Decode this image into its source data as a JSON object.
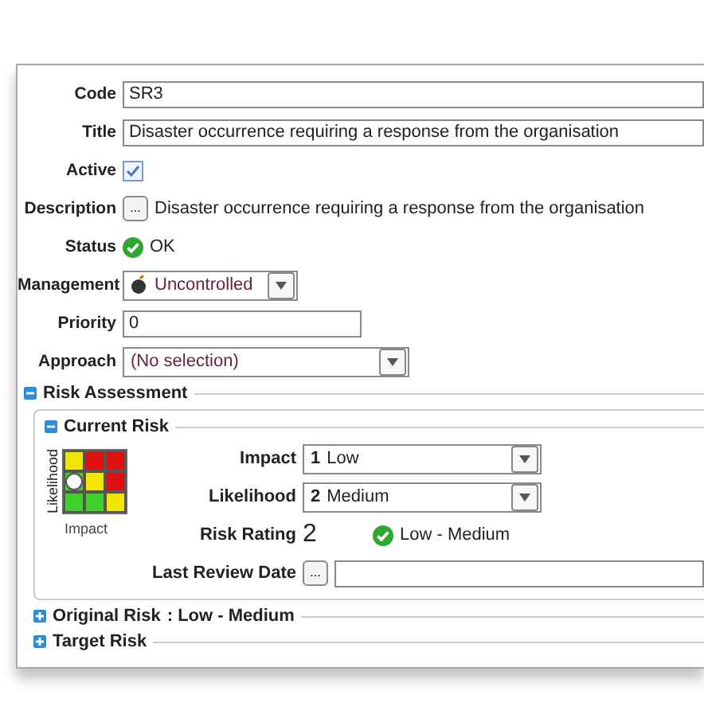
{
  "fields": [
    {
      "kind": "text",
      "label": "Code",
      "value": "SR3"
    },
    {
      "kind": "text",
      "label": "Title",
      "value": "Disaster occurrence requiring a response from the organisation"
    },
    {
      "kind": "checkbox",
      "label": "Active",
      "checked": true
    },
    {
      "kind": "ellipsis",
      "label": "Description",
      "button": "...",
      "value": "Disaster occurrence requiring a response from the organisation"
    },
    {
      "kind": "status",
      "label": "Status",
      "value": "OK"
    },
    {
      "kind": "select",
      "label": "Management",
      "value": "Uncontrolled",
      "icon": true
    },
    {
      "kind": "short",
      "label": "Priority",
      "value": "0"
    },
    {
      "kind": "select",
      "label": "Approach",
      "value": "(No selection)",
      "icon": false
    }
  ],
  "risk_assessment": {
    "title": "Risk Assessment",
    "expanded": true,
    "current_risk": {
      "title": "Current Risk",
      "expanded": true,
      "matrix": {
        "ylabel": "Likelihood",
        "xlabel": "Impact",
        "rows": [
          [
            {
              "color": "#f2e600",
              "selected": false
            },
            {
              "color": "#e01010",
              "selected": false
            },
            {
              "color": "#e01010",
              "selected": false
            }
          ],
          [
            {
              "color": "#3fcf2a",
              "selected": true
            },
            {
              "color": "#f2e600",
              "selected": false
            },
            {
              "color": "#e01010",
              "selected": false
            }
          ],
          [
            {
              "color": "#3fcf2a",
              "selected": false
            },
            {
              "color": "#3fcf2a",
              "selected": false
            },
            {
              "color": "#f2e600",
              "selected": false
            }
          ]
        ]
      },
      "impact": {
        "label": "Impact",
        "number": "1",
        "value": "Low"
      },
      "likelihood": {
        "label": "Likelihood",
        "number": "2",
        "value": "Medium"
      },
      "rating": {
        "label": "Risk Rating",
        "value": "2",
        "text": "Low - Medium"
      },
      "review": {
        "label": "Last Review Date",
        "button": "..."
      }
    },
    "others": [
      {
        "title": "Original Risk",
        "summary": ": Low - Medium",
        "expanded": false
      },
      {
        "title": "Target Risk",
        "expanded": false
      }
    ]
  }
}
